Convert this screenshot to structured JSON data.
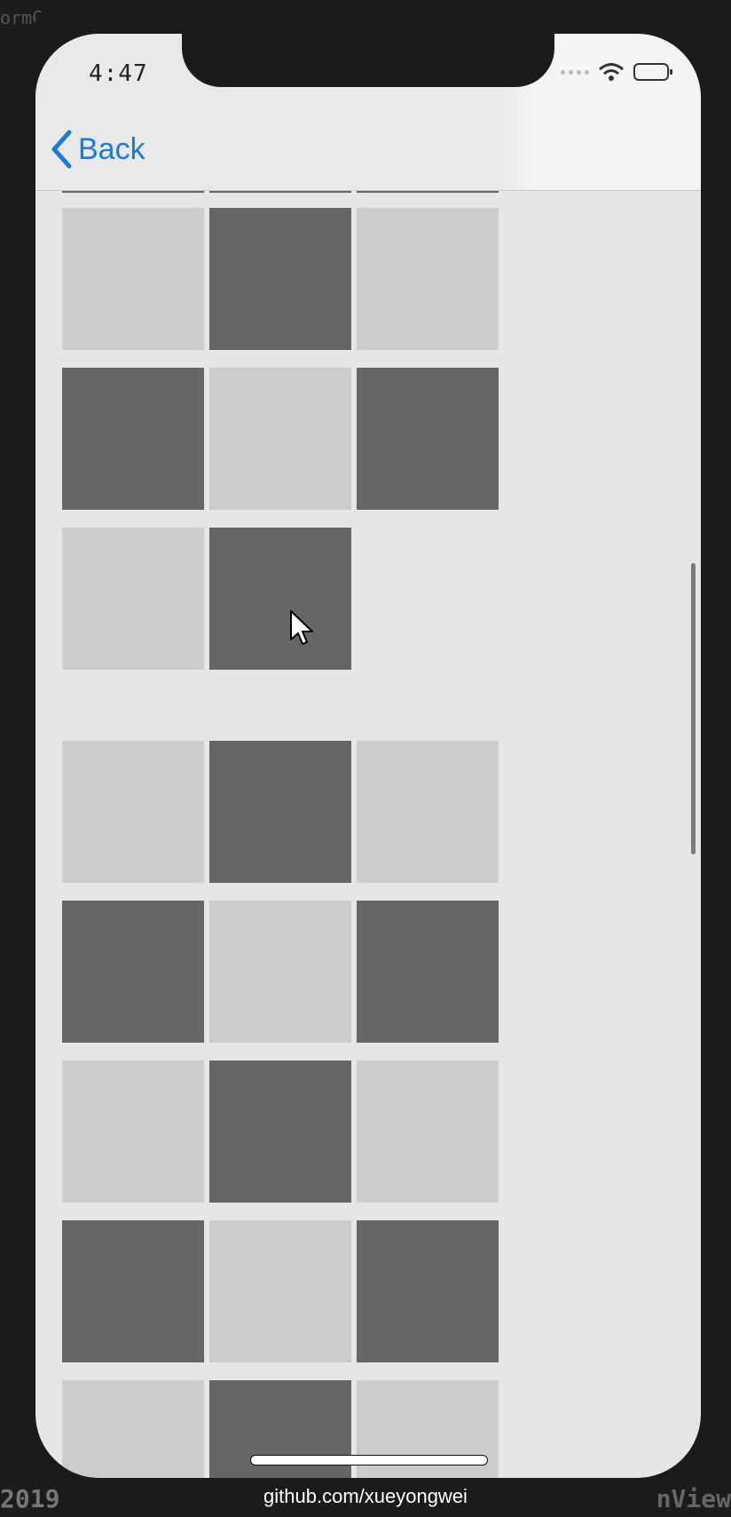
{
  "background": {
    "top_left_fragment": "ormCo",
    "bottom_left_fragment": "2019",
    "bottom_right_fragment": "nView",
    "watermark": "github.com/xueyongwei"
  },
  "status_bar": {
    "time": "4:47",
    "icons": [
      "signal-dots-icon",
      "wifi-icon",
      "battery-icon"
    ]
  },
  "nav_bar": {
    "back_label": "Back",
    "back_icon": "chevron-left-icon"
  },
  "colors": {
    "accent": "#1c7ad8",
    "cell_light": "#cccccc",
    "cell_dark": "#666666",
    "background": "#e6e6e6"
  },
  "grid": {
    "sections": [
      {
        "rows": [
          [
            "light",
            "dark",
            "light"
          ],
          [
            "dark",
            "light",
            "dark"
          ],
          [
            "light",
            "dark"
          ]
        ]
      },
      {
        "rows": [
          [
            "light",
            "dark",
            "light"
          ],
          [
            "dark",
            "light",
            "dark"
          ],
          [
            "light",
            "dark",
            "light"
          ],
          [
            "dark",
            "light",
            "dark"
          ],
          [
            "light",
            "dark",
            "light"
          ]
        ]
      }
    ]
  }
}
